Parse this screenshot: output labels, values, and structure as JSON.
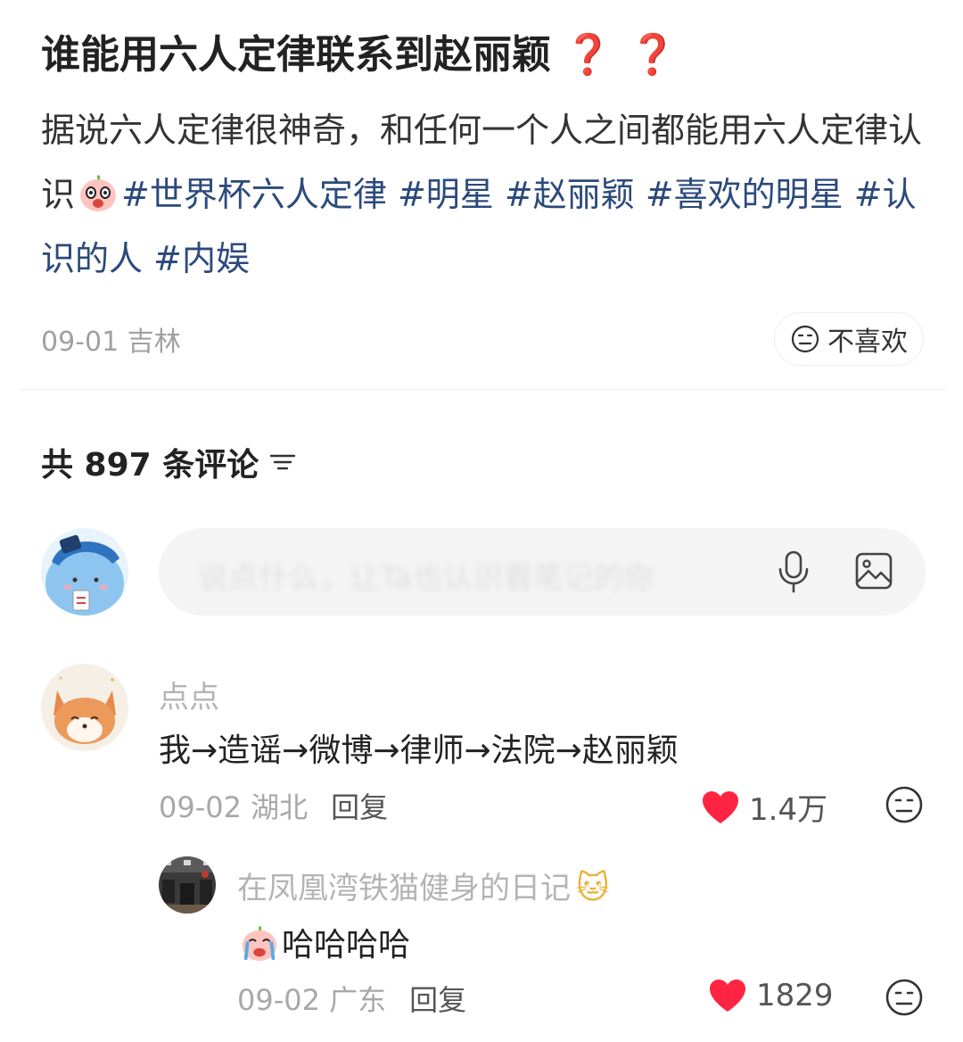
{
  "post": {
    "title": "谁能用六人定律联系到赵丽颖",
    "title_marks": "❓❓",
    "body_text": "据说六人定律很神奇，和任何一个人之间都能用六人定律认识",
    "tags": [
      "#世界杯六人定律",
      "#明星",
      "#赵丽颖",
      "#喜欢的明星",
      "#认识的人",
      "#内娱"
    ],
    "date": "09-01",
    "location": "吉林",
    "dislike_label": "不喜欢"
  },
  "comments_header": {
    "label": "共 897 条评论"
  },
  "comment_input": {
    "placeholder": "说点什么，让Ta也认识看笔记的你"
  },
  "comments": [
    {
      "user": "点点",
      "text": "我→造谣→微博→律师→法院→赵丽颖",
      "date": "09-02",
      "location": "湖北",
      "reply_label": "回复",
      "likes": "1.4万"
    },
    {
      "user": "在凤凰湾铁猫健身的日记",
      "user_emoji": "🐱",
      "text": "哈哈哈哈",
      "date": "09-02",
      "location": "广东",
      "reply_label": "回复",
      "likes": "1829"
    }
  ],
  "colors": {
    "tag": "#2b4a7c",
    "like_heart": "#ff2442",
    "title_marks": "#e8333b"
  }
}
